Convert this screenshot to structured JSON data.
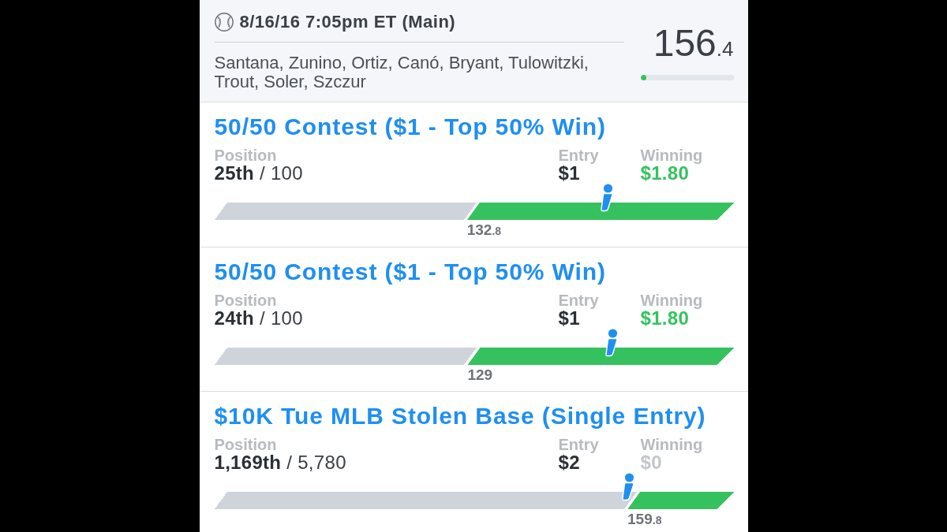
{
  "header": {
    "title": "8/16/16 7:05pm ET (Main)",
    "players": "Santana, Zunino, Ortiz, Canó, Bryant, Tulowitzki, Trout, Soler, Szczur",
    "score": {
      "whole": "156",
      "fraction": ".4"
    },
    "progress": {
      "level": 0.06
    }
  },
  "contests": [
    {
      "title": "50/50 Contest ($1 - Top 50% Win)",
      "position_label": "Position",
      "position": "**25th** / 100",
      "entry_label": "Entry",
      "entry": "$1",
      "winning_label": "Winning",
      "winning": "$1.80",
      "in_the_money": true,
      "bar": {
        "level": 0.511,
        "cutoff": {
          "whole": "132",
          "fraction": ".8"
        },
        "marker": {
          "level": 0.748
        }
      }
    },
    {
      "title": "50/50 Contest ($1 - Top 50% Win)",
      "position_label": "Position",
      "position": "**24th** / 100",
      "entry_label": "Entry",
      "entry": "$1",
      "winning_label": "Winning",
      "winning": "$1.80",
      "in_the_money": true,
      "bar": {
        "level": 0.512,
        "cutoff": {
          "whole": "129"
        },
        "marker": {
          "level": 0.758
        }
      }
    },
    {
      "title": "$10K Tue MLB Stolen Base (Single Entry)",
      "position_label": "Position",
      "position": "**1,169th** / 5,780",
      "entry_label": "Entry",
      "entry": "$2",
      "winning_label": "Winning",
      "winning": "$0",
      "in_the_money": false,
      "bar": {
        "level": 0.82,
        "cutoff": {
          "whole": "159",
          "fraction": ".8"
        },
        "marker": {
          "level": 0.789
        }
      }
    }
  ]
}
